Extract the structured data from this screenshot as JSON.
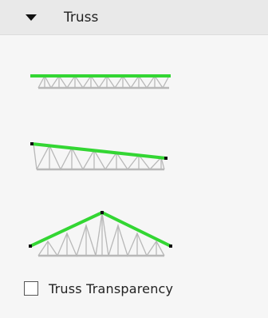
{
  "panel": {
    "title": "Truss",
    "expanded": true,
    "toggle_icon": "caret-down-icon"
  },
  "truss_options": [
    {
      "name": "flat-truss",
      "icon": "flat-truss-icon"
    },
    {
      "name": "mono-pitch-truss",
      "icon": "mono-pitch-truss-icon"
    },
    {
      "name": "gable-truss",
      "icon": "gable-truss-icon"
    }
  ],
  "transparency": {
    "label": "Truss Transparency",
    "checked": false
  },
  "colors": {
    "top_chord": "#33d633",
    "web": "#b8b8b8",
    "node": "#111111"
  }
}
